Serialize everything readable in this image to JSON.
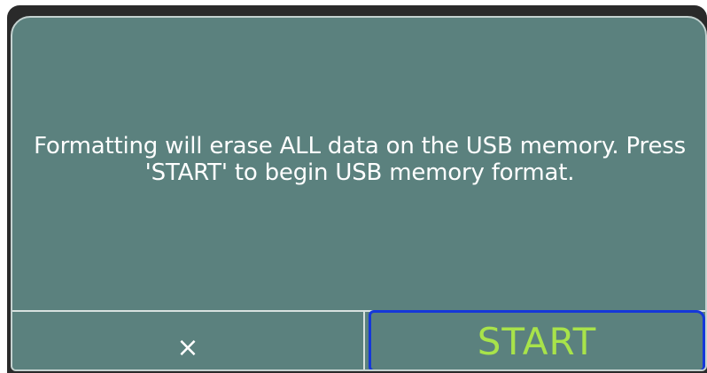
{
  "dialog": {
    "message": "Formatting will erase ALL data on the USB memory. Press\n'START' to begin USB memory format."
  },
  "buttons": {
    "cancel_icon": "×",
    "start_label": "START"
  },
  "colors": {
    "dialog_background": "#5b817e",
    "start_text": "#a8e34a",
    "focus_border": "#1538d9"
  }
}
